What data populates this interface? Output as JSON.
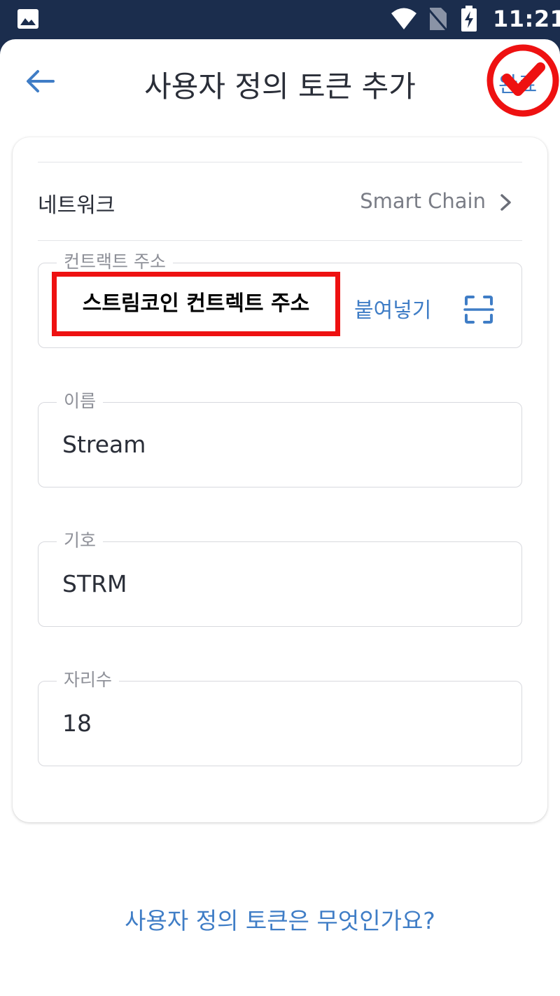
{
  "status_bar": {
    "time": "11:21",
    "icons": [
      "gallery-icon",
      "wifi-icon",
      "no-sim-icon",
      "battery-charging-icon"
    ]
  },
  "app_bar": {
    "title": "사용자 정의 토큰 추가",
    "back_icon": "arrow-left-icon",
    "done_label": "완료",
    "accent_color": "#3f7dc6"
  },
  "form": {
    "network": {
      "label": "네트워크",
      "value": "Smart Chain"
    },
    "contract": {
      "label": "컨트랙트 주소",
      "value": "스트림코인 컨트렉트 주소",
      "paste_label": "붙여넣기",
      "scan_icon": "qr-scan-icon"
    },
    "name": {
      "label": "이름",
      "value": "Stream"
    },
    "symbol": {
      "label": "기호",
      "value": "STRM"
    },
    "decimals": {
      "label": "자리수",
      "value": "18"
    }
  },
  "help_link": "사용자 정의 토큰은 무엇인가요?",
  "annotations": {
    "color": "#ee1111"
  }
}
